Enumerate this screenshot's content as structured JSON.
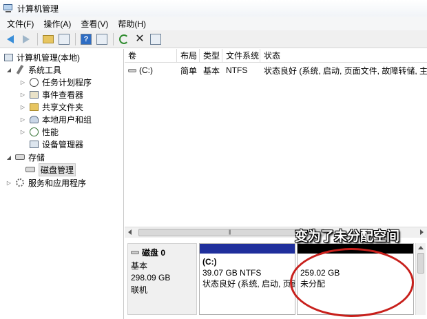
{
  "window": {
    "title": "计算机管理"
  },
  "menu": [
    "文件(F)",
    "操作(A)",
    "查看(V)",
    "帮助(H)"
  ],
  "toolbar": {
    "buttons": [
      "back-arrow-icon",
      "forward-arrow-icon",
      "up-folder-icon",
      "show-hide-tree-icon",
      "help-icon",
      "properties-icon",
      "refresh-icon",
      "delete-icon",
      "export-icon"
    ]
  },
  "tree": {
    "root": "计算机管理(本地)",
    "system_tools": "系统工具",
    "task_scheduler": "任务计划程序",
    "event_viewer": "事件查看器",
    "shared_folders": "共享文件夹",
    "local_users": "本地用户和组",
    "performance": "性能",
    "device_manager": "设备管理器",
    "storage": "存储",
    "disk_management": "磁盘管理",
    "services_apps": "服务和应用程序"
  },
  "volume_list": {
    "columns": [
      "卷",
      "布局",
      "类型",
      "文件系统",
      "状态"
    ],
    "rows": [
      {
        "volume": "(C:)",
        "layout": "简单",
        "type": "基本",
        "fs": "NTFS",
        "status": "状态良好 (系统, 启动, 页面文件, 故障转储, 主分区)"
      }
    ]
  },
  "disk": {
    "name": "磁盘 0",
    "type": "基本",
    "size": "298.09 GB",
    "state": "联机",
    "partitions": [
      {
        "title": "(C:)",
        "size": "39.07 GB NTFS",
        "status": "状态良好 (系统, 启动, 页面",
        "bar_color": "#1f2f9c"
      },
      {
        "title": "",
        "size": "259.02 GB",
        "status": "未分配",
        "bar_color": "#000000"
      }
    ]
  },
  "annotation": {
    "text": "变为了未分配空间",
    "color": "#c8201c"
  }
}
